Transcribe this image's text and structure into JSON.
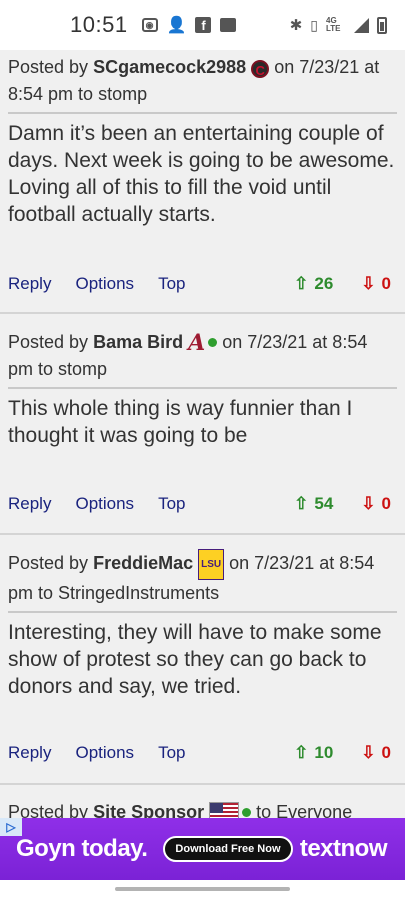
{
  "status_bar": {
    "time": "10:51",
    "icons": [
      "screen-record-icon",
      "add-contact-icon",
      "facebook-icon",
      "image-icon",
      "bluetooth-icon",
      "vibrate-icon",
      "signal-icon",
      "battery-icon"
    ],
    "network": "4G LTE"
  },
  "posts": [
    {
      "prefix": "Posted by",
      "author": "SCgamecock2988",
      "badge": "South Carolina logo",
      "date_text": "on 7/23/21 at 8:54 pm to",
      "reply_to": "stomp",
      "body": "Damn it’s been an entertaining couple of days. Next week is going to be awesome. Loving all of this to fill the void until football actually starts.",
      "actions": {
        "reply": "Reply",
        "options": "Options",
        "top": "Top"
      },
      "upvotes": "26",
      "downvotes": "0"
    },
    {
      "prefix": "Posted by",
      "author": "Bama Bird",
      "badge": "Alabama A logo",
      "date_text": "on 7/23/21 at 8:54 pm to",
      "reply_to": "stomp",
      "body": "This whole thing is way funnier than I thought it was going to be",
      "actions": {
        "reply": "Reply",
        "options": "Options",
        "top": "Top"
      },
      "upvotes": "54",
      "downvotes": "0"
    },
    {
      "prefix": "Posted by",
      "author": "FreddieMac",
      "badge": "LSU",
      "date_text": "on 7/23/21 at 8:54 pm to",
      "reply_to": "StringedInstruments",
      "body": "Interesting, they will have to make some show of protest so they can go back to donors and say, we tried.",
      "actions": {
        "reply": "Reply",
        "options": "Options",
        "top": "Top"
      },
      "upvotes": "10",
      "downvotes": "0"
    },
    {
      "prefix": "Posted by",
      "author": "Site Sponsor",
      "date_text": "to",
      "reply_to": "Everyone"
    }
  ],
  "ad": {
    "choice_icon": "ad-choices-icon",
    "headline": "Goyn today.",
    "cta": "Download Free Now",
    "brand": "textnow",
    "color": "#8f2fe8"
  },
  "colors": {
    "link": "#1a237e",
    "upvote": "#2e8b2e",
    "downvote": "#cc1111"
  }
}
